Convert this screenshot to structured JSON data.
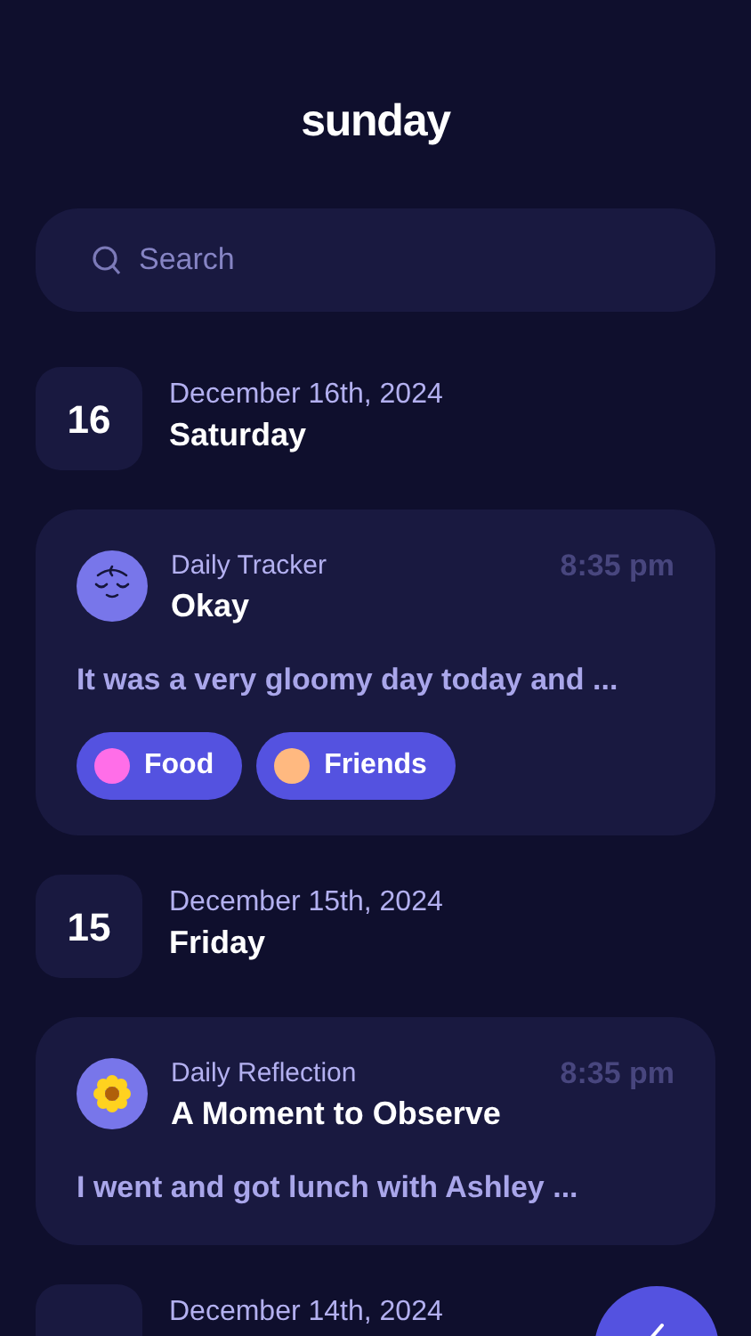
{
  "app_title": "sunday",
  "search": {
    "placeholder": "Search"
  },
  "days": [
    {
      "day_number": "16",
      "date": "December 16th, 2024",
      "weekday": "Saturday",
      "entries": [
        {
          "kind": "tracker",
          "category": "Daily Tracker",
          "title": "Okay",
          "time": "8:35 pm",
          "excerpt": "It was a very gloomy day today and ...",
          "tags": [
            {
              "label": "Food",
              "color": "#ff6ee8"
            },
            {
              "label": "Friends",
              "color": "#ffb980"
            }
          ]
        }
      ]
    },
    {
      "day_number": "15",
      "date": "December 15th, 2024",
      "weekday": "Friday",
      "entries": [
        {
          "kind": "reflection",
          "category": "Daily Reflection",
          "title": "A Moment to Observe",
          "time": "8:35 pm",
          "excerpt": "I went and got lunch with Ashley ..."
        }
      ]
    },
    {
      "date": "December 14th, 2024"
    }
  ]
}
